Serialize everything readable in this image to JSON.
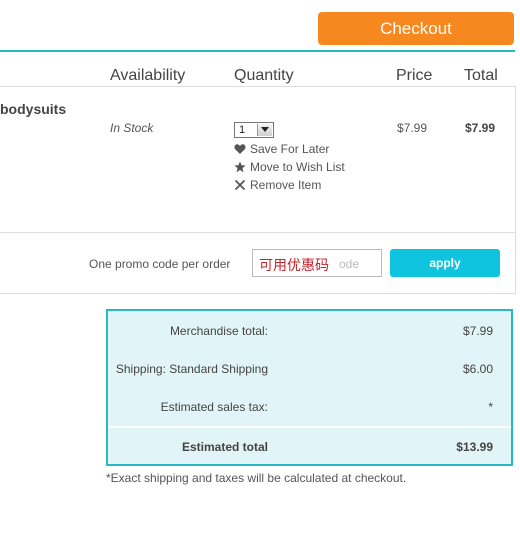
{
  "header": {
    "checkout_label": "Checkout"
  },
  "columns": {
    "availability": "Availability",
    "quantity": "Quantity",
    "price": "Price",
    "total": "Total"
  },
  "item": {
    "name": "bodysuits",
    "availability": "In Stock",
    "quantity": "1",
    "price": "$7.99",
    "total": "$7.99",
    "actions": {
      "save_for_later": "Save For Later",
      "move_to_wish_list": "Move to Wish List",
      "remove_item": "Remove Item"
    }
  },
  "promo": {
    "label": "One promo code per order",
    "placeholder": "ode",
    "overlay_text": "可用优惠码",
    "apply_label": "apply"
  },
  "summary": {
    "merch_label": "Merchandise total:",
    "merch_value": "$7.99",
    "shipping_label": "Shipping: Standard Shipping",
    "shipping_value": "$6.00",
    "tax_label": "Estimated sales tax:",
    "tax_value": "*",
    "total_label": "Estimated total",
    "total_value": "$13.99",
    "note": "*Exact shipping and taxes will be calculated at checkout."
  },
  "colors": {
    "accent_orange": "#f7881f",
    "accent_teal": "#27b9c5",
    "apply_blue": "#0fc4de",
    "summary_bg": "#e1f4f7"
  }
}
